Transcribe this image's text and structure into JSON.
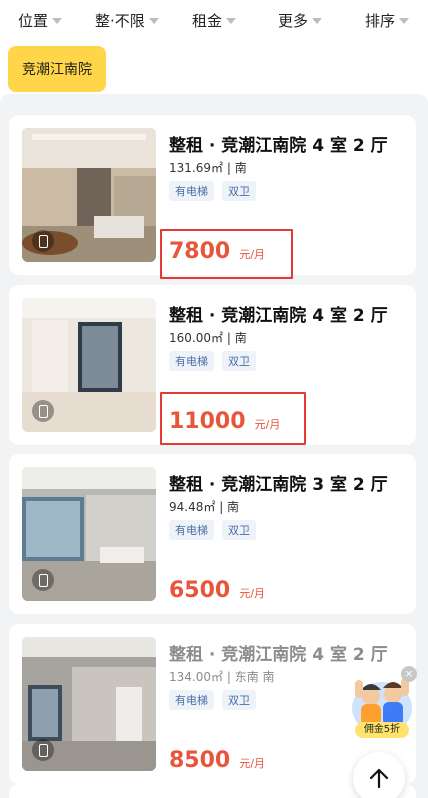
{
  "filters": [
    {
      "label": "位置"
    },
    {
      "label": "整·不限"
    },
    {
      "label": "租金"
    },
    {
      "label": "更多"
    },
    {
      "label": "排序"
    }
  ],
  "tag": "竞潮江南院",
  "listings": [
    {
      "title": "整租 · 竞潮江南院 4 室 2 厅",
      "area": "131.69㎡",
      "orientation": "南",
      "tags": [
        "有电梯",
        "双卫"
      ],
      "price": "7800",
      "price_unit": "元/月",
      "highlighted": true
    },
    {
      "title": "整租 · 竞潮江南院 4 室 2 厅",
      "area": "160.00㎡",
      "orientation": "南",
      "tags": [
        "有电梯",
        "双卫"
      ],
      "price": "11000",
      "price_unit": "元/月",
      "highlighted": true
    },
    {
      "title": "整租 · 竞潮江南院 3 室 2 厅",
      "area": "94.48㎡",
      "orientation": "南",
      "tags": [
        "有电梯",
        "双卫"
      ],
      "price": "6500",
      "price_unit": "元/月",
      "highlighted": false
    },
    {
      "title": "整租 · 竞潮江南院 4 室 2 厅",
      "area": "134.00㎡",
      "orientation": "东南 南",
      "tags": [
        "有电梯",
        "双卫"
      ],
      "price": "8500",
      "price_unit": "元/月",
      "highlighted": false
    }
  ],
  "promo": {
    "label": "佣金5折"
  },
  "icons": {
    "dropdown": "triangle-down-icon",
    "vr": "vr-icon",
    "close": "close-icon",
    "back_to_top": "arrow-up-icon"
  },
  "colors": {
    "price": "#e8553a",
    "tag_chip": "#ffd54a",
    "highlight_box": "#e53935"
  }
}
